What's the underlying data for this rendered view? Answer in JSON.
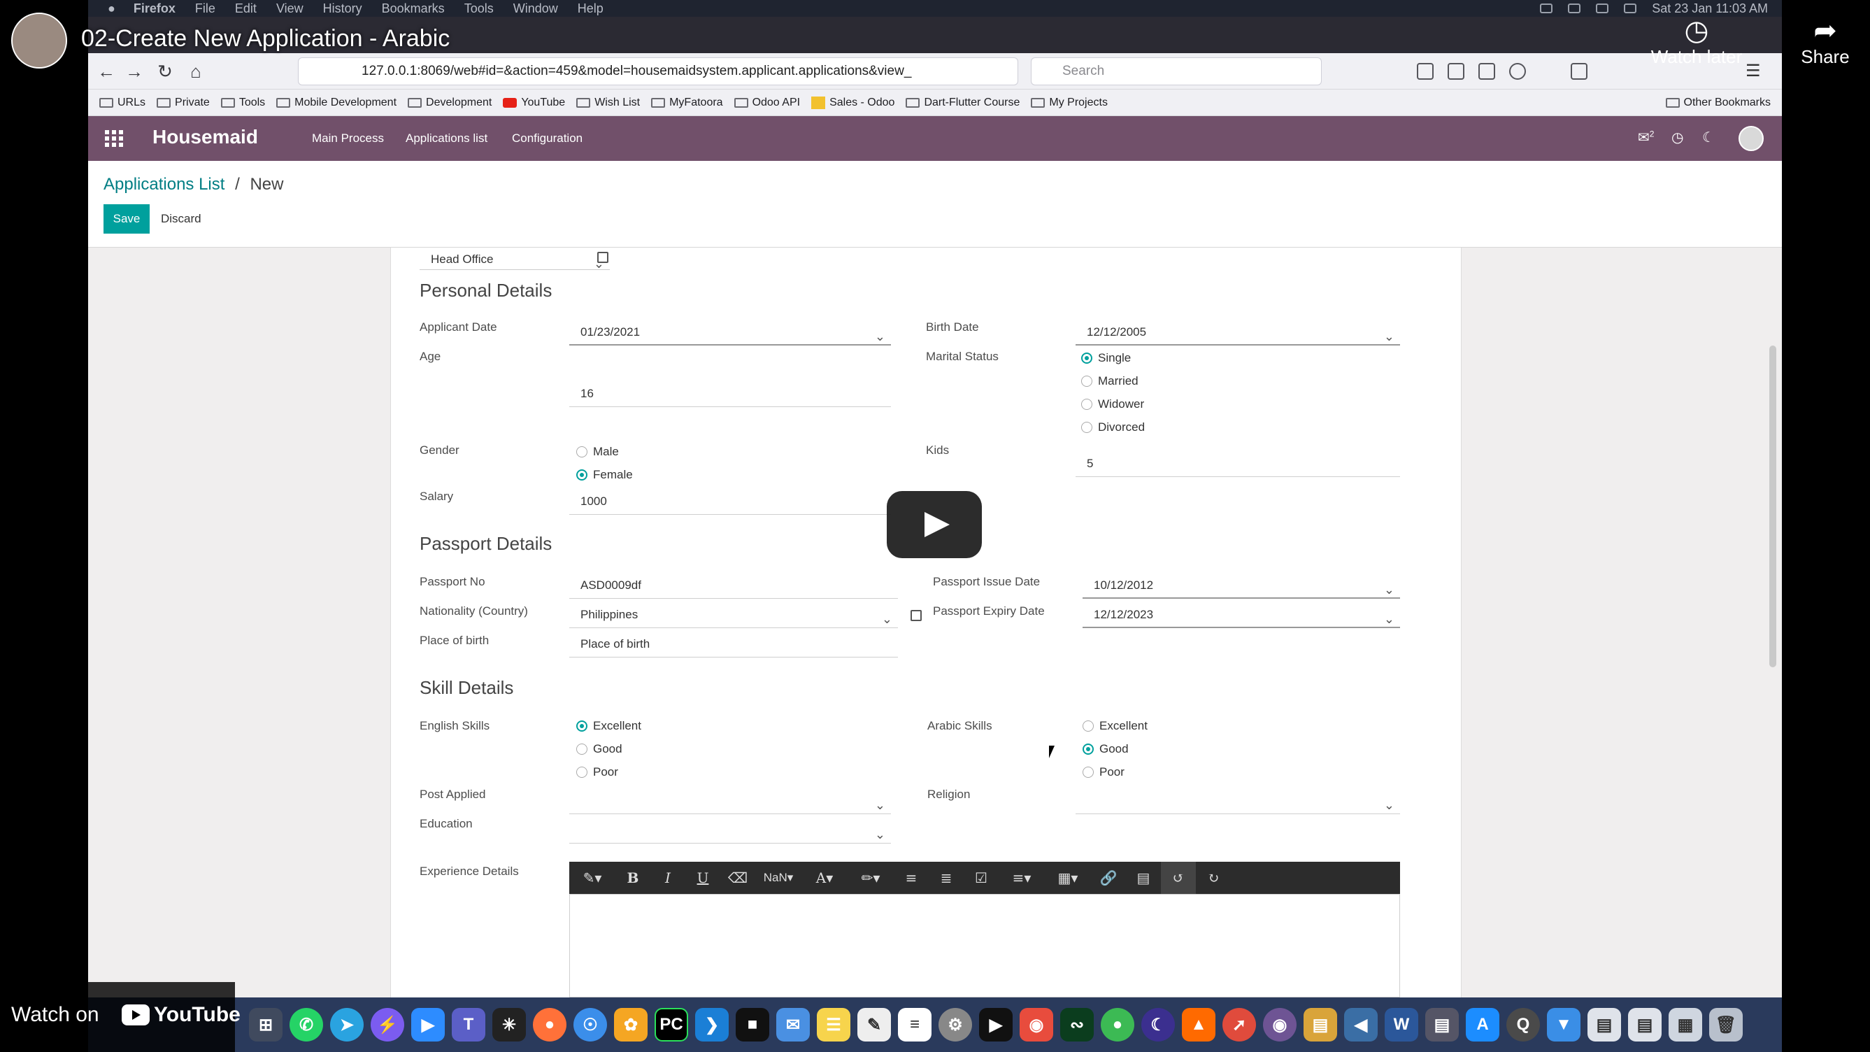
{
  "mac_menu": {
    "app": "Firefox",
    "items": [
      "File",
      "Edit",
      "View",
      "History",
      "Bookmarks",
      "Tools",
      "Window",
      "Help"
    ],
    "clock": "Sat 23 Jan  11:03 AM"
  },
  "browser": {
    "url": "127.0.0.1:8069/web#id=&action=459&model=housemaidsystem.applicant.applications&view_",
    "search_placeholder": "Search"
  },
  "bookmarks": [
    {
      "label": "URLs",
      "icon": "folder-icon"
    },
    {
      "label": "Private",
      "icon": "folder-icon"
    },
    {
      "label": "Tools",
      "icon": "folder-icon"
    },
    {
      "label": "Mobile Development",
      "icon": "folder-icon"
    },
    {
      "label": "Development",
      "icon": "folder-icon"
    },
    {
      "label": "YouTube",
      "icon": "youtube-icon"
    },
    {
      "label": "Wish List",
      "icon": "folder-icon"
    },
    {
      "label": "MyFatoora",
      "icon": "folder-icon"
    },
    {
      "label": "Odoo API",
      "icon": "folder-icon"
    },
    {
      "label": "Sales - Odoo",
      "icon": "sales-icon"
    },
    {
      "label": "Dart-Flutter Course",
      "icon": "folder-icon"
    },
    {
      "label": "My Projects",
      "icon": "folder-icon"
    }
  ],
  "other_bookmarks": "Other Bookmarks",
  "app": {
    "brand": "Housemaid",
    "menu": [
      "Main Process",
      "Applications list",
      "Configuration"
    ],
    "chat_count": "2"
  },
  "breadcrumb": {
    "parent": "Applications List",
    "sep": "/",
    "current": "New"
  },
  "buttons": {
    "save": "Save",
    "discard": "Discard"
  },
  "form": {
    "head_office": "Head Office",
    "personal": {
      "title": "Personal Details",
      "applicant_date_label": "Applicant Date",
      "applicant_date": "01/23/2021",
      "birth_date_label": "Birth Date",
      "birth_date": "12/12/2005",
      "age_label": "Age",
      "age": "16",
      "marital_label": "Marital Status",
      "marital_options": [
        "Single",
        "Married",
        "Widower",
        "Divorced"
      ],
      "marital_selected": "Single",
      "gender_label": "Gender",
      "gender_options": [
        "Male",
        "Female"
      ],
      "gender_selected": "Female",
      "kids_label": "Kids",
      "kids": "5",
      "salary_label": "Salary",
      "salary": "1000"
    },
    "passport": {
      "title": "Passport Details",
      "no_label": "Passport No",
      "no": "ASD0009df",
      "issue_label": "Passport Issue Date",
      "issue": "10/12/2012",
      "nationality_label": "Nationality (Country)",
      "nationality": "Philippines",
      "expiry_label": "Passport Expiry Date",
      "expiry": "12/12/2023",
      "pob_label": "Place of birth",
      "pob": "Place of birth"
    },
    "skills": {
      "title": "Skill Details",
      "english_label": "English Skills",
      "english_options": [
        "Excellent",
        "Good",
        "Poor"
      ],
      "english_selected": "Excellent",
      "arabic_label": "Arabic Skills",
      "arabic_options": [
        "Excellent",
        "Good",
        "Poor"
      ],
      "arabic_selected": "Good",
      "post_label": "Post Applied",
      "religion_label": "Religion",
      "education_label": "Education",
      "experience_label": "Experience Details"
    },
    "editor_font_size": "NaN"
  },
  "youtube": {
    "title": "02-Create New Application - Arabic",
    "watch_later": "Watch later",
    "share": "Share",
    "watch_on": "Watch on",
    "brand": "YouTube"
  },
  "colors": {
    "odoo_nav": "#71506a",
    "accent": "#00a09d",
    "link": "#017e84"
  }
}
